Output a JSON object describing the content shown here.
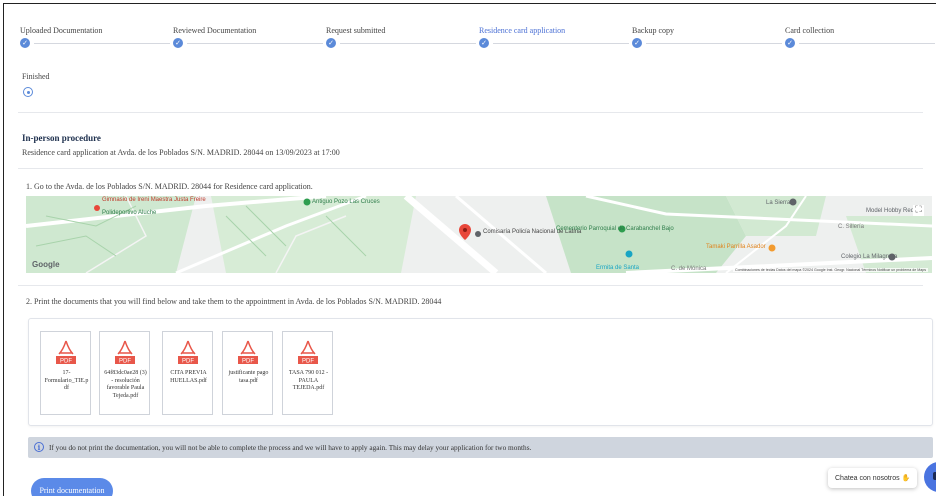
{
  "steps": [
    {
      "label": "Uploaded Documentation",
      "state": "done"
    },
    {
      "label": "Reviewed Documentation",
      "state": "done"
    },
    {
      "label": "Request submitted",
      "state": "done"
    },
    {
      "label": "Residence card application",
      "state": "active"
    },
    {
      "label": "Backup copy",
      "state": "done"
    },
    {
      "label": "Card collection",
      "state": "done"
    }
  ],
  "finished": {
    "label": "Finished"
  },
  "procedure": {
    "title": "In-person procedure",
    "subtitle": "Residence card application at Avda. de los Poblados S/N. MADRID. 28044 on 13/09/2023 at 17:00",
    "step1": "1. Go to the Avda. de los Poblados S/N. MADRID. 28044 for Residence card application.",
    "step2": "2. Print the documents that you will find below and take them to the appointment in Avda. de los Poblados S/N. MADRID. 28044"
  },
  "map": {
    "labels": {
      "poli": "Polideportivo Aluche",
      "gym": "Gimnasio de Ireni Maestra Justa Freire",
      "pozo": "Antiguo Pozo Las Cruces",
      "comisaria": "Comisaría Policía Nacional de Latina",
      "cementerio": "Cementerio Parroquial de Carabanchel Bajo",
      "ermita": "Ermita de Santa",
      "lasierra": "La Sierra",
      "hobby": "Model Hobby Red",
      "parrilla": "Tamaki Parrilla Asador",
      "colegio": "Colegio La Milagrosa",
      "street1": "C. de Mónica",
      "street2": "C. Sillería",
      "street3": "Av. de los Poblados"
    },
    "google": "Google",
    "footer": "Combinaciones de teclas   Datos del mapa ©2024 Google Inst. Geogr. Nacional   Términos   Notificar un problema de Maps"
  },
  "documents": [
    {
      "name": "17-Formulario_TIE.pdf",
      "icon": "pdf-icon",
      "badge": "PDF"
    },
    {
      "name": "64f83dc0ae28 (3) - resolución favorable Paula Tejeda.pdf",
      "icon": "pdf-icon",
      "badge": "PDF"
    },
    {
      "name": "CITA PREVIA HUELLAS.pdf",
      "icon": "pdf-icon",
      "badge": "PDF"
    },
    {
      "name": "justificante pago tasa.pdf",
      "icon": "pdf-icon",
      "badge": "PDF"
    },
    {
      "name": "TASA 790 012 - PAULA TEJEDA.pdf",
      "icon": "pdf-icon",
      "badge": "PDF"
    }
  ],
  "warning": {
    "icon": "info-icon",
    "text": "If you do not print the documentation, you will not be able to complete the process and we will have to apply again. This may delay your application for two months."
  },
  "print_button": {
    "label": "Print documentation"
  },
  "chat": {
    "label": "Chatea con nosotros",
    "icon": "wave-hand-icon"
  },
  "colors": {
    "accent": "#5b8ad9",
    "button": "#5b8ae8",
    "warning_bg": "#cfd5de",
    "pdf_red": "#e8574a"
  }
}
